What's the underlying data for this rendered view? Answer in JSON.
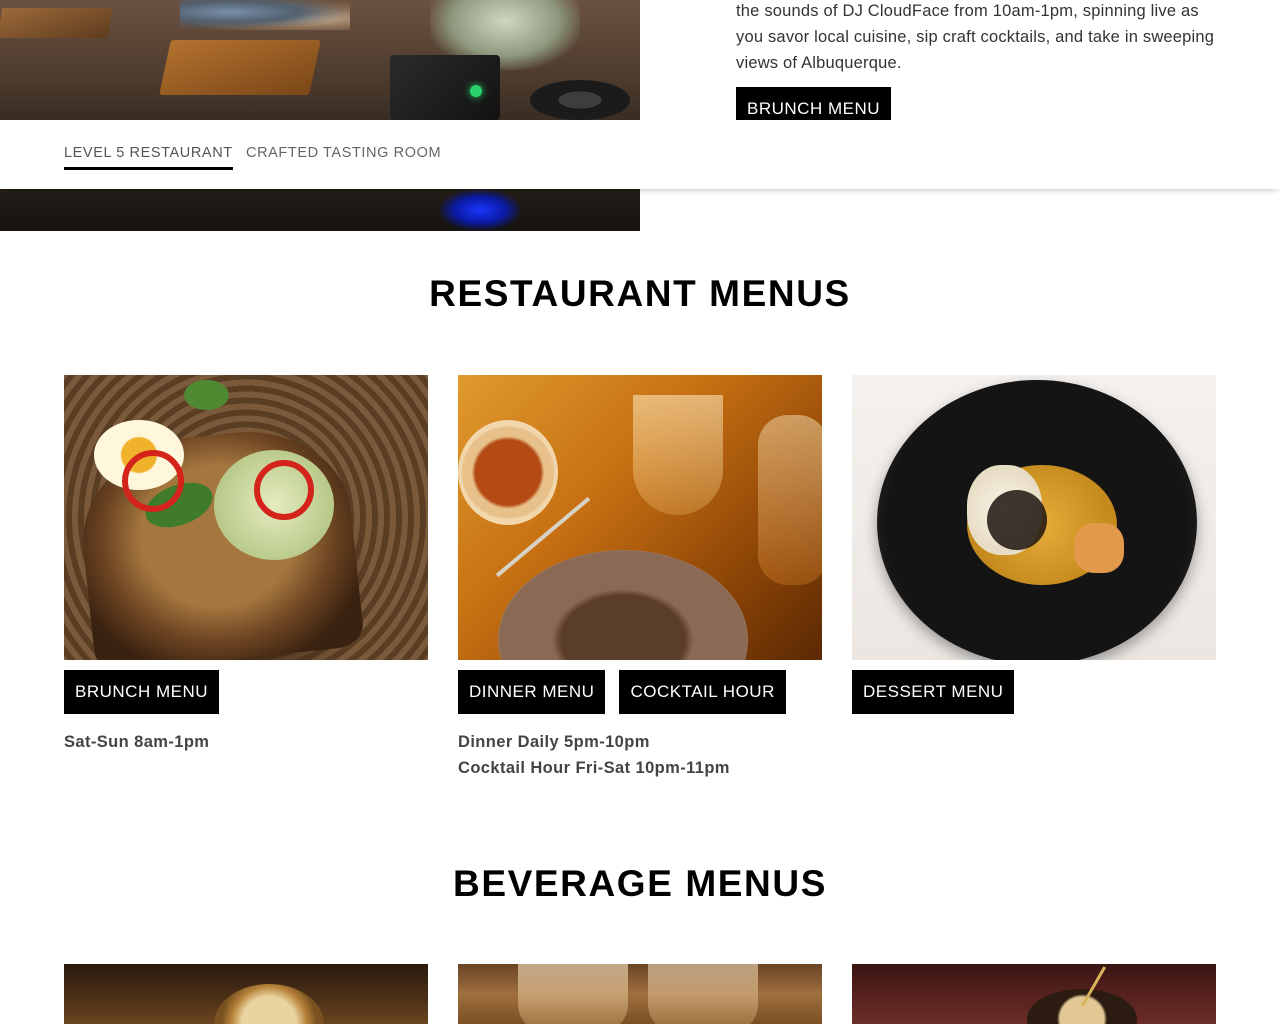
{
  "hero": {
    "description": "the sounds of DJ CloudFace from 10am-1pm, spinning live as you savor local cuisine, sip craft cocktails, and take in sweeping views of Albuquerque.",
    "button_label": "BRUNCH MENU"
  },
  "tabs": [
    {
      "label": "LEVEL 5 RESTAURANT",
      "active": true
    },
    {
      "label": "CRAFTED TASTING ROOM",
      "active": false
    }
  ],
  "restaurant": {
    "title": "RESTAURANT MENUS",
    "cards": [
      {
        "buttons": [
          "BRUNCH MENU"
        ],
        "hours": [
          "Sat-Sun 8am-1pm"
        ]
      },
      {
        "buttons": [
          "DINNER MENU",
          "COCKTAIL HOUR"
        ],
        "hours": [
          "Dinner Daily 5pm-10pm",
          "Cocktail Hour Fri-Sat 10pm-11pm"
        ]
      },
      {
        "buttons": [
          "DESSERT MENU"
        ],
        "hours": []
      }
    ]
  },
  "beverage": {
    "title": "BEVERAGE MENUS"
  },
  "colors": {
    "button_bg": "#000000",
    "button_text": "#ffffff",
    "body_text": "#333333",
    "tab_underline": "#000000"
  }
}
